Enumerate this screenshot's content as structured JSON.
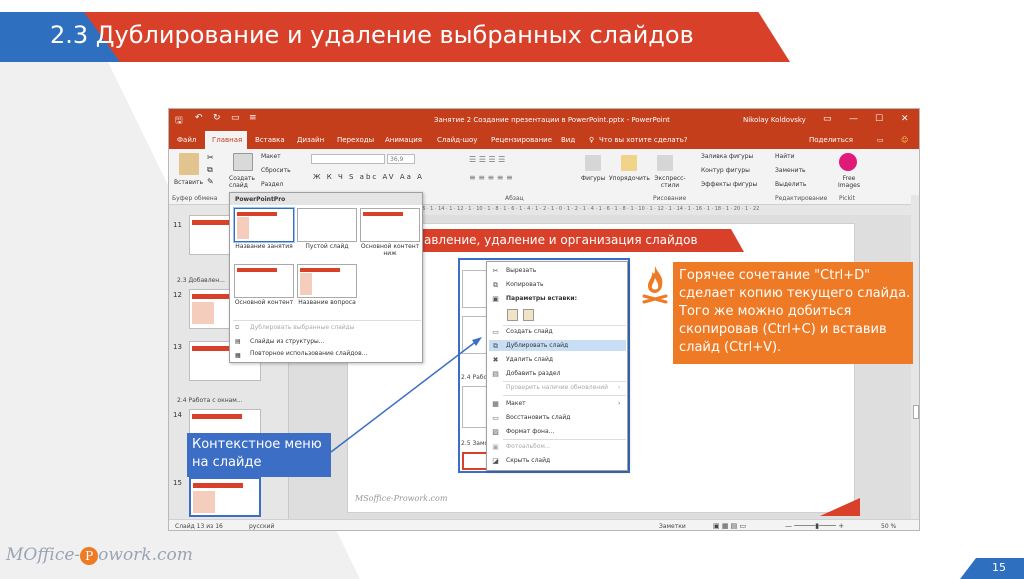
{
  "slide": {
    "title": "2.3 Дублирование и удаление выбранных слайдов",
    "page_number": "15",
    "footer_logo_left": "MOffice-",
    "footer_logo_right": "owork.com",
    "footer_logo_p": "P"
  },
  "window": {
    "title": "Занятие 2 Создание презентации в PowerPoint.pptx - PowerPoint",
    "user": "Nikolay Koldovsky",
    "controls": [
      "▭",
      "—",
      "☐",
      "✕"
    ],
    "qat": [
      "🖫",
      "↶",
      "↻",
      "▭",
      "≡"
    ]
  },
  "tabs": [
    "Файл",
    "Главная",
    "Вставка",
    "Дизайн",
    "Переходы",
    "Анимация",
    "Слайд-шоу",
    "Рецензирование",
    "Вид",
    "Что вы хотите сделать?"
  ],
  "share": "Поделиться",
  "ribbon": {
    "paste": "Вставить",
    "clipboard": "Буфер обмена",
    "new_slide": "Создать слайд",
    "layout": "Макет",
    "reset": "Сбросить",
    "section": "Раздел",
    "font_size": "36,9",
    "font_buttons": "Ж К Ч S abc AV Aa A",
    "paragraph": "Абзац",
    "shapes": "Фигуры",
    "arrange": "Упорядочить",
    "quick_styles": "Экспресс-стили",
    "shape_fill": "Заливка фигуры",
    "shape_outline": "Контур фигуры",
    "shape_effects": "Эффекты фигуры",
    "drawing": "Рисование",
    "find": "Найти",
    "replace": "Заменить",
    "select": "Выделить",
    "editing": "Редактирование",
    "free_images": "Free Images",
    "pickit": "Pickit"
  },
  "ruler": "16 · 1 · 14 · 1 · 12 · 1 · 10 · 1 · 8 · 1 · 6 · 1 · 4 · 1 · 2 · 1 · 0 · 1 · 2 · 1 · 4 · 1 · 6 · 1 · 8 · 1 · 10 · 1 · 12 · 1 · 14 · 1 · 16 · 1 · 18 · 1 · 20 · 1 · 22",
  "thumbs": {
    "n11": "11",
    "sect23": "2.3 Добавлен...",
    "n12": "12",
    "n13": "13",
    "sect24": "2.4 Работа с окнам...",
    "n14": "14",
    "n15": "15"
  },
  "layout_dropdown": {
    "header": "PowerPointPro",
    "layouts": [
      {
        "label": "Название занятия"
      },
      {
        "label": "Пустой слайд"
      },
      {
        "label": "Основной контент ниж"
      },
      {
        "label": "Основной контент"
      },
      {
        "label": "Название вопроса"
      }
    ],
    "menu": [
      {
        "label": "Дублировать выбранные слайды",
        "disabled": true
      },
      {
        "label": "Слайды из структуры...",
        "disabled": false
      },
      {
        "label": "Повторное использование слайдов...",
        "disabled": false
      }
    ]
  },
  "inner_slide": {
    "band_text": "авление, удаление и организация слайдов",
    "logo": "MSoffice-Prowork.com",
    "sect24": "2.4 Рабо",
    "sect25": "2.5 Замо"
  },
  "context_menu": {
    "cut": "Вырезать",
    "copy": "Копировать",
    "paste_options": "Параметры вставки:",
    "new_slide": "Создать слайд",
    "duplicate": "Дублировать слайд",
    "delete": "Удалить слайд",
    "add_section": "Добавить раздел",
    "check_updates": "Проверить наличие обновлений",
    "layout": "Макет",
    "reset": "Восстановить слайд",
    "format_bg": "Формат фона...",
    "photo_album": "Фотоальбом...",
    "hide": "Скрыть слайд"
  },
  "callouts": {
    "orange": "Горячее сочетание \"Ctrl+D\" сделает копию текущего слайда. Того же можно добиться скопировав (Ctrl+C) и вставив слайд (Ctrl+V).",
    "blue": "Контекстное меню на слайде"
  },
  "status": {
    "slide_count": "Слайд 13 из 16",
    "language": "русский",
    "notes": "Заметки",
    "zoom": "50 %"
  },
  "colors": {
    "accent_red": "#d9402a",
    "accent_blue": "#2f6fc0",
    "callout_orange": "#ee7a25",
    "ppt_red": "#c43e1c"
  }
}
